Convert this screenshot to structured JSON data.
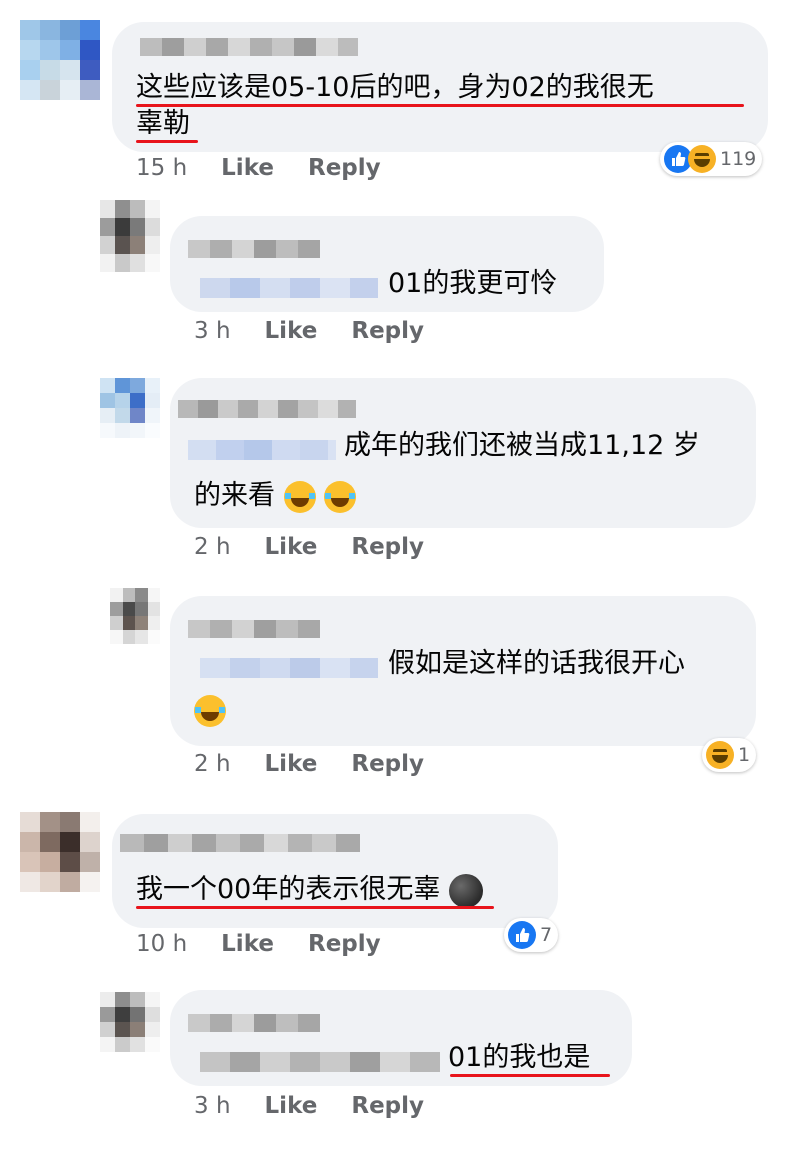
{
  "comments": [
    {
      "text_lines": [
        "这些应该是05-10后的吧，身为02的我很无",
        "辜勒"
      ],
      "time": "15 h",
      "like_label": "Like",
      "reply_label": "Reply",
      "reactions": {
        "icons": [
          "like-icon",
          "haha-icon"
        ],
        "count": "119"
      }
    },
    {
      "text": "01的我更可怜",
      "time": "3 h",
      "like_label": "Like",
      "reply_label": "Reply"
    },
    {
      "text_lines": [
        "成年的我们还被当成11,12 岁",
        "的来看"
      ],
      "time": "2 h",
      "like_label": "Like",
      "reply_label": "Reply",
      "inline_emojis": [
        "laughing-tears-emoji",
        "laughing-tears-emoji"
      ]
    },
    {
      "text": "假如是这样的话我很开心",
      "time": "2 h",
      "like_label": "Like",
      "reply_label": "Reply",
      "inline_emojis": [
        "laughing-tears-emoji"
      ],
      "reactions": {
        "icons": [
          "haha-icon"
        ],
        "count": "1"
      }
    },
    {
      "text": "我一个00年的表示很无辜",
      "time": "10 h",
      "like_label": "Like",
      "reply_label": "Reply",
      "inline_emojis": [
        "new-moon-face-emoji"
      ],
      "reactions": {
        "icons": [
          "like-icon"
        ],
        "count": "7"
      }
    },
    {
      "text": "01的我也是",
      "time": "3 h",
      "like_label": "Like",
      "reply_label": "Reply"
    }
  ],
  "colors": {
    "bubble": "#f0f2f5",
    "meta_text": "#65676b",
    "underline": "#e8141b",
    "like_blue": "#1877f2",
    "haha_yellow": "#f7b125"
  }
}
